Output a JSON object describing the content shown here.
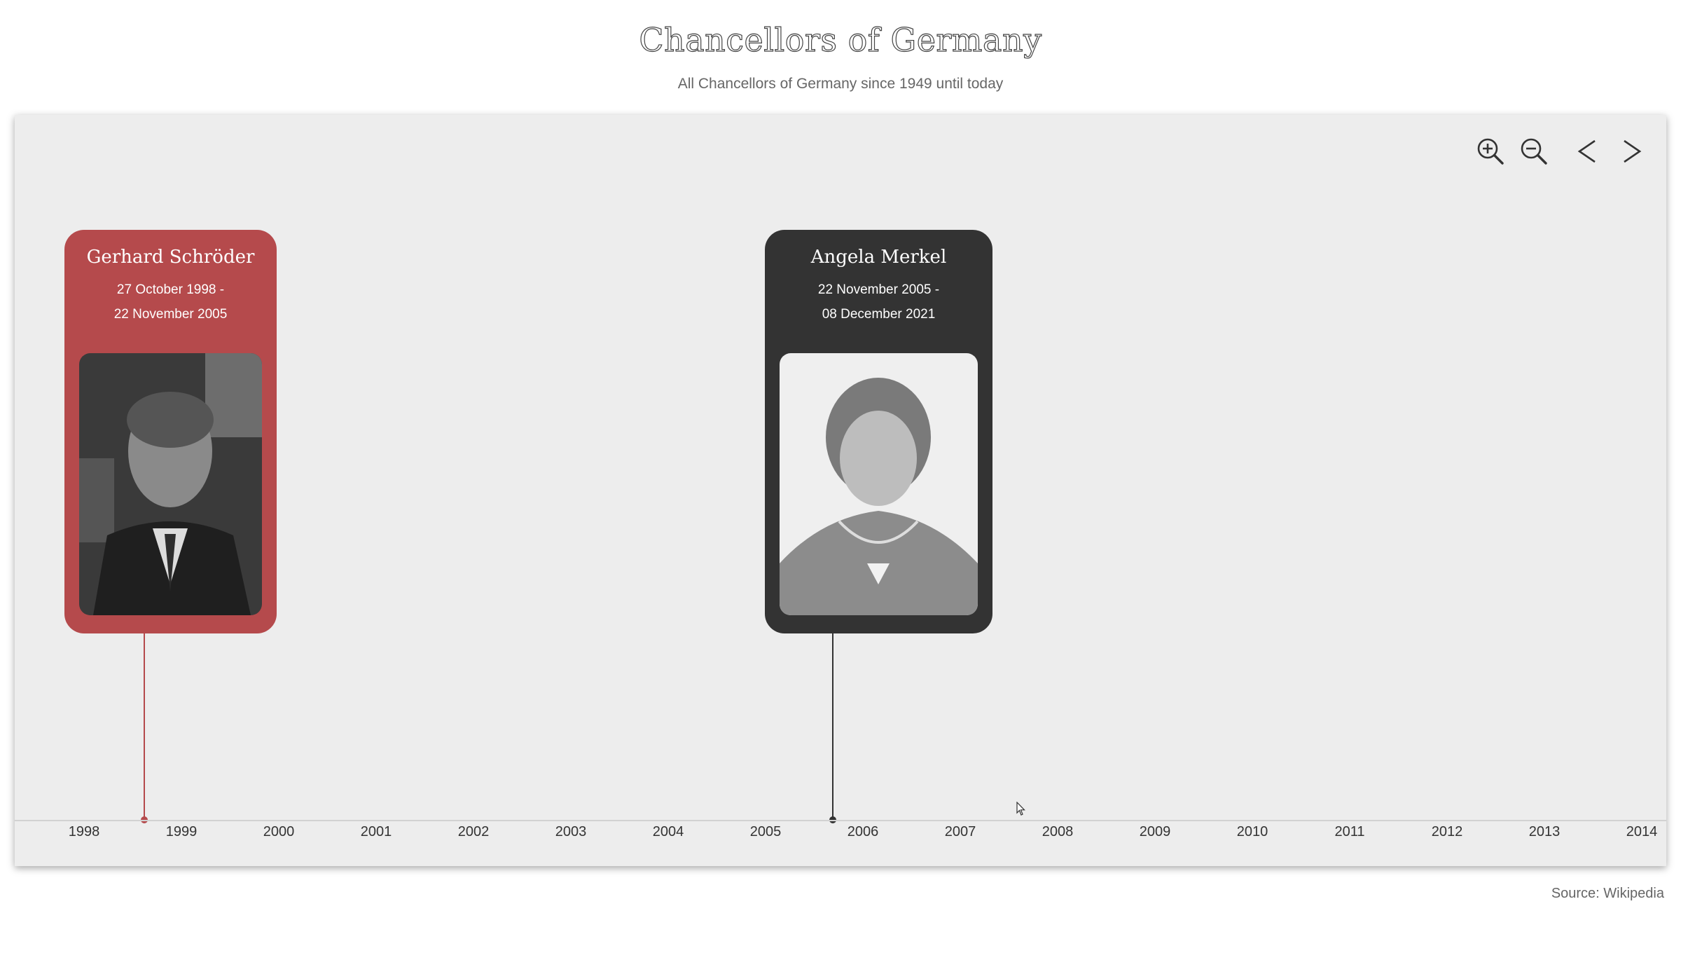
{
  "header": {
    "title": "Chancellors of Germany",
    "subtitle": "All Chancellors of Germany since 1949 until today"
  },
  "toolbar": {
    "zoom_in_icon": "zoom-in-icon",
    "zoom_out_icon": "zoom-out-icon",
    "prev_icon": "chevron-left-icon",
    "next_icon": "chevron-right-icon"
  },
  "timeline": {
    "years": [
      "1998",
      "1999",
      "2000",
      "2001",
      "2002",
      "2003",
      "2004",
      "2005",
      "2006",
      "2007",
      "2008",
      "2009",
      "2010",
      "2011",
      "2012",
      "2013",
      "2014"
    ],
    "events": [
      {
        "name": "Gerhard Schröder",
        "date_start": "27 October 1998 -",
        "date_end": "22 November 2005",
        "color": "#b54a4c"
      },
      {
        "name": "Angela Merkel",
        "date_start": "22 November 2005 -",
        "date_end": "08 December 2021",
        "color": "#333333"
      }
    ]
  },
  "footer": {
    "source": "Source: Wikipedia"
  },
  "colors": {
    "panel_background": "#ededed",
    "accent_red": "#b54a4c",
    "accent_dark": "#333333"
  }
}
